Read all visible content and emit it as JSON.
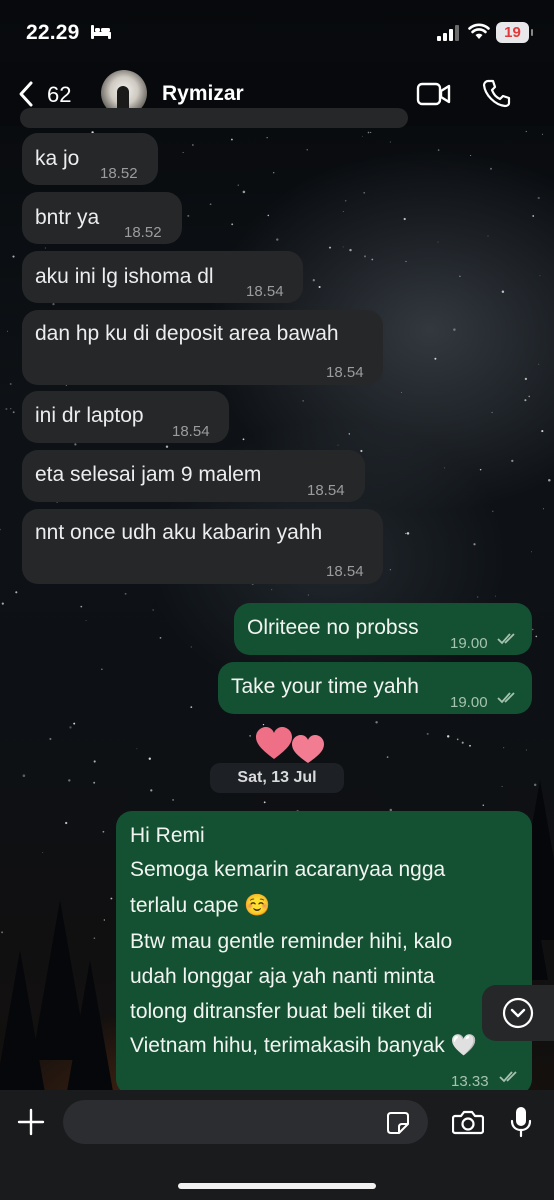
{
  "status_bar": {
    "time": "22.29",
    "battery": "19"
  },
  "header": {
    "back_count": "62",
    "contact_name": "Rymizar"
  },
  "messages": [
    {
      "text": "ka jo",
      "time": "18.52"
    },
    {
      "text": "bntr ya",
      "time": "18.52"
    },
    {
      "text": "aku ini lg ishoma dl",
      "time": "18.54"
    },
    {
      "text": "dan hp ku di deposit area bawah",
      "time": "18.54"
    },
    {
      "text": "ini dr laptop",
      "time": "18.54"
    },
    {
      "text": "eta selesai jam 9 malem",
      "time": "18.54"
    },
    {
      "text": "nnt once udh aku kabarin yahh",
      "time": "18.54"
    },
    {
      "text": "Olriteee no probss",
      "time": "19.00"
    },
    {
      "text": "Take your time yahh",
      "time": "19.00"
    }
  ],
  "date_separator": "Sat, 13 Jul",
  "long_message": {
    "lines": [
      "Hi Remi",
      "Semoga kemarin acaranyaa ngga",
      "terlalu cape ☺️",
      "Btw mau gentle reminder hihi, kalo",
      "udah longgar aja yah nanti minta",
      "tolong ditransfer buat beli tiket di",
      "Vietnam hihu, terimakasih banyak 🤍"
    ],
    "time": "13.33"
  },
  "colors": {
    "incoming_bubble": "#262729",
    "outgoing_bubble": "#145132",
    "input_bar": "#1a1b1d"
  },
  "icons": [
    "bed-icon",
    "signal-icon",
    "wifi-icon",
    "chevron-left-icon",
    "video-call-icon",
    "phone-icon",
    "heart-icon",
    "chevron-down-circle-icon",
    "plus-icon",
    "sticker-icon",
    "camera-icon",
    "microphone-icon",
    "double-check-icon"
  ]
}
